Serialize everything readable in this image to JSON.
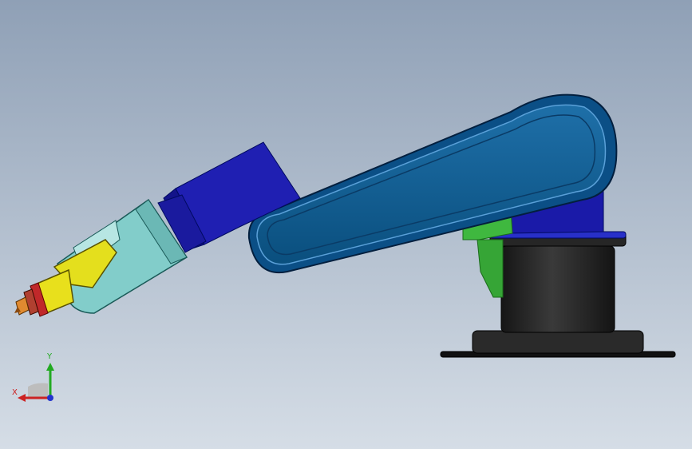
{
  "viewport": {
    "background_top": "#8fa0b6",
    "background_bottom": "#d5dde6"
  },
  "model": {
    "colors": {
      "arm_blue": "#0a5a8a",
      "joint_navy": "#1a1aa8",
      "wrist_cyan": "#7fc9c7",
      "gripper_yellow": "#e0dc1c",
      "tool_red": "#c0282a",
      "bracket_green": "#3fb83f",
      "base_black": "#1c1c1c"
    }
  },
  "triad": {
    "x_label": "X",
    "y_label": "Y",
    "x_color": "#cc2222",
    "y_color": "#22aa22",
    "z_color": "#2233cc"
  }
}
